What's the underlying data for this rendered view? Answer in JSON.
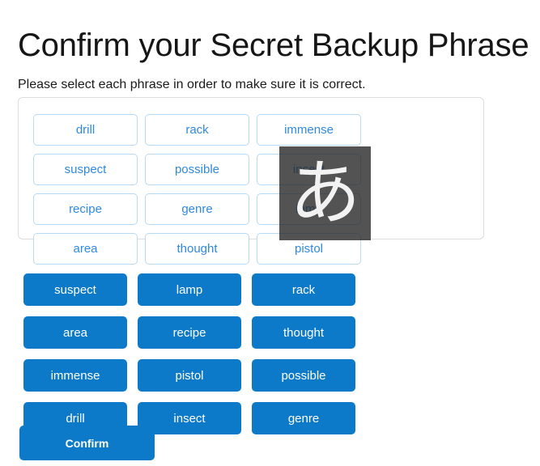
{
  "header": {
    "title": "Confirm your Secret Backup Phrase",
    "subtitle": "Please select each phrase in order to make sure it is correct."
  },
  "selected_panel": {
    "chips": [
      {
        "label": "drill"
      },
      {
        "label": "rack"
      },
      {
        "label": "immense"
      },
      {
        "label": "suspect"
      },
      {
        "label": "possible"
      },
      {
        "label": "insect"
      },
      {
        "label": "recipe"
      },
      {
        "label": "genre"
      },
      {
        "label": "lamp"
      },
      {
        "label": "area"
      },
      {
        "label": "thought"
      },
      {
        "label": "pistol"
      }
    ]
  },
  "word_bank": {
    "buttons": [
      {
        "label": "suspect"
      },
      {
        "label": "lamp"
      },
      {
        "label": "rack"
      },
      {
        "label": "area"
      },
      {
        "label": "recipe"
      },
      {
        "label": "thought"
      },
      {
        "label": "immense"
      },
      {
        "label": "pistol"
      },
      {
        "label": "possible"
      },
      {
        "label": "drill"
      },
      {
        "label": "insect"
      },
      {
        "label": "genre"
      }
    ]
  },
  "actions": {
    "confirm_label": "Confirm"
  },
  "ime_overlay": {
    "glyph": "あ",
    "icon_name": "ime-hiragana-indicator",
    "background_color": "#282828",
    "text_color": "#f2f2f2"
  },
  "colors": {
    "accent_blue": "#0d7ac9",
    "chip_text_blue": "#3089e0",
    "chip_border_blue": "#b6d9f5",
    "panel_border_gray": "#dddddd",
    "heading_text": "#161616"
  }
}
